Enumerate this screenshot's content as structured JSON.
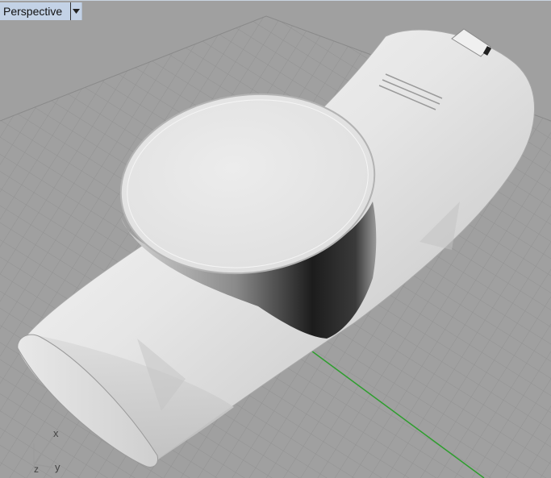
{
  "viewport": {
    "title": "Perspective",
    "menu_icon": "dropdown-arrow-icon",
    "background_color": "#a0a0a0",
    "grid_color": "#8e8e8e",
    "axis_colors": {
      "x": "#c62828",
      "y": "#2e9e2e"
    }
  },
  "axes_widget": {
    "x_label": "x",
    "y_label": "y",
    "z_label": "z"
  },
  "model": {
    "description_icon": "3d-model-shaded"
  }
}
